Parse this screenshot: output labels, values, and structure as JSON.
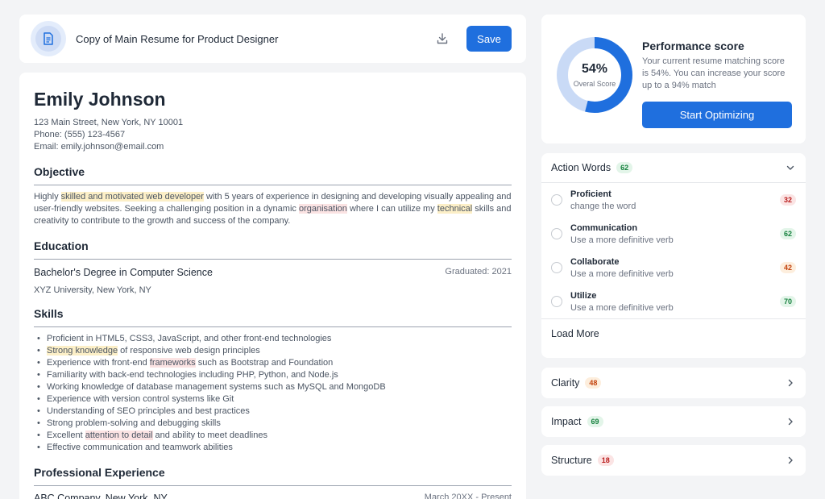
{
  "document": {
    "title": "Copy of Main Resume for Product Designer",
    "save_label": "Save"
  },
  "resume": {
    "name": "Emily Johnson",
    "address": "123 Main Street, New York, NY 10001",
    "phone": "Phone: (555) 123-4567",
    "email": "Email: emily.johnson@email.com",
    "objective": {
      "heading": "Objective",
      "p1": "Highly ",
      "h1": "skilled and motivated web developer",
      "p2": " with 5 years of experience in designing and developing visually appealing and user-friendly websites. Seeking a challenging position in a dynamic ",
      "h2": "organisation",
      "p3": " where I can utilize my ",
      "h3": "technical",
      "p4": " skills and creativity to contribute to the growth and success of the company."
    },
    "education": {
      "heading": "Education",
      "degree": "Bachelor's Degree in Computer Science",
      "graduated": "Graduated: 2021",
      "university": "XYZ University, New York, NY"
    },
    "skills": {
      "heading": "Skills",
      "s1": "Proficient in HTML5, CSS3, JavaScript, and other front-end technologies",
      "s2_hl": "Strong knowledge",
      "s2_rest": " of responsive web design principles",
      "s3_pre": "Experience with front-end ",
      "s3_hl": "frameworks",
      "s3_rest": " such as Bootstrap and Foundation",
      "s4": "Familiarity with back-end technologies including PHP, Python, and Node.js",
      "s5": "Working knowledge of database management systems such as MySQL and MongoDB",
      "s6": "Experience with version control systems like Git",
      "s7": "Understanding of SEO principles and best practices",
      "s8": "Strong problem-solving and debugging skills",
      "s9_pre": "Excellent ",
      "s9_hl": "attention to detail",
      "s9_rest": " and ability to meet deadlines",
      "s10": "Effective communication and teamwork abilities"
    },
    "experience": {
      "heading": "Professional Experience",
      "company": "ABC Company, New York, NY",
      "dates": "March 20XX - Present"
    }
  },
  "score": {
    "percent_label": "54%",
    "percent_value": 54,
    "overall_label": "Overal Score",
    "title": "Performance score",
    "description": "Your current resume matching score is 54%. You can increase your score up to a 94% match",
    "button_label": "Start Optimizing"
  },
  "action_words": {
    "title": "Action Words",
    "count": "62",
    "items": [
      {
        "name": "Proficient",
        "hint": "change the word",
        "score": "32",
        "color": "red"
      },
      {
        "name": "Communication",
        "hint": "Use a more definitive verb",
        "score": "62",
        "color": "green"
      },
      {
        "name": "Collaborate",
        "hint": "Use a more definitive verb",
        "score": "42",
        "color": "orange"
      },
      {
        "name": "Utilize",
        "hint": "Use a more definitive verb",
        "score": "70",
        "color": "green"
      }
    ],
    "load_more": "Load More"
  },
  "sections": [
    {
      "title": "Clarity",
      "count": "48",
      "color": "orange"
    },
    {
      "title": "Impact",
      "count": "69",
      "color": "green"
    },
    {
      "title": "Structure",
      "count": "18",
      "color": "red"
    }
  ],
  "colors": {
    "accent": "#1f6fde",
    "donut_track": "#c9daf6",
    "donut_fill": "#1f6fde"
  }
}
